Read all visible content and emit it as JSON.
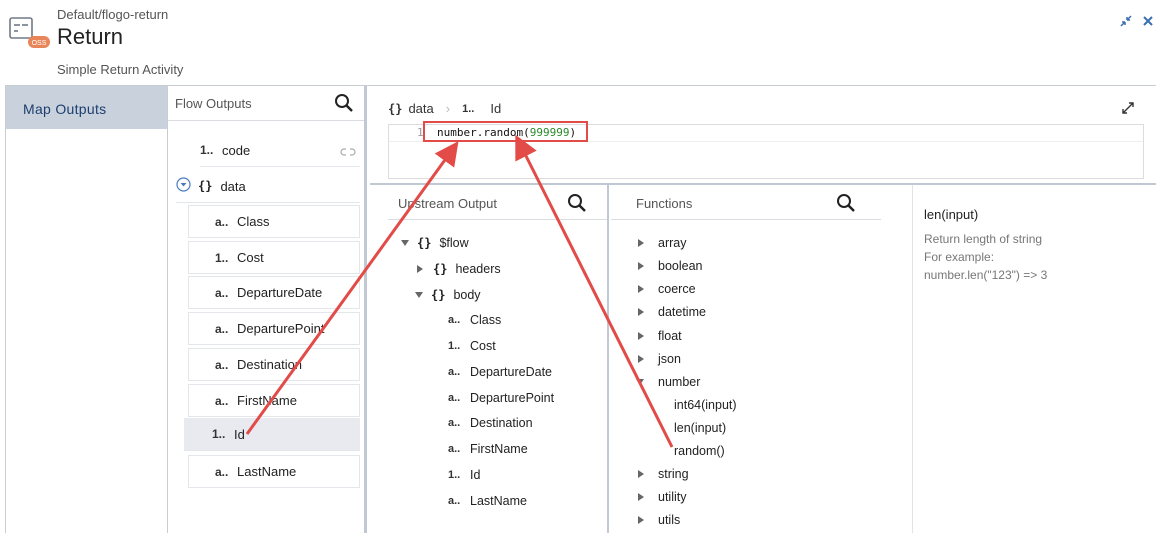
{
  "header": {
    "breadcrumb": "Default/flogo-return",
    "title": "Return",
    "subtitle": "Simple Return Activity",
    "badge": "OSS"
  },
  "nav": {
    "items": [
      {
        "label": "Map Outputs",
        "active": true
      }
    ]
  },
  "flow_outputs": {
    "title": "Flow Outputs",
    "rows": [
      {
        "type": "1..",
        "label": "code"
      },
      {
        "type": "{}",
        "label": "data"
      },
      {
        "type": "a..",
        "label": "Class"
      },
      {
        "type": "1..",
        "label": "Cost"
      },
      {
        "type": "a..",
        "label": "DepartureDate"
      },
      {
        "type": "a..",
        "label": "DeparturePoint"
      },
      {
        "type": "a..",
        "label": "Destination"
      },
      {
        "type": "a..",
        "label": "FirstName"
      },
      {
        "type": "1..",
        "label": "Id",
        "selected": true
      },
      {
        "type": "a..",
        "label": "LastName"
      }
    ]
  },
  "editor": {
    "crumb": {
      "parent": "data",
      "type": "1..",
      "field": "Id"
    },
    "line_number": "1",
    "code_fn": "number.random(",
    "code_arg": "999999",
    "code_close": ")"
  },
  "upstream": {
    "title": "Upstream Output",
    "tree": [
      {
        "label": "$flow",
        "type": "{}",
        "expanded": true
      },
      {
        "label": "headers",
        "type": "{}",
        "expanded": false
      },
      {
        "label": "body",
        "type": "{}",
        "expanded": true
      },
      {
        "label": "Class",
        "type": "a.."
      },
      {
        "label": "Cost",
        "type": "1.."
      },
      {
        "label": "DepartureDate",
        "type": "a.."
      },
      {
        "label": "DeparturePoint",
        "type": "a.."
      },
      {
        "label": "Destination",
        "type": "a.."
      },
      {
        "label": "FirstName",
        "type": "a.."
      },
      {
        "label": "Id",
        "type": "1.."
      },
      {
        "label": "LastName",
        "type": "a.."
      }
    ]
  },
  "functions": {
    "title": "Functions",
    "groups": [
      {
        "label": "array"
      },
      {
        "label": "boolean"
      },
      {
        "label": "coerce"
      },
      {
        "label": "datetime"
      },
      {
        "label": "float"
      },
      {
        "label": "json"
      },
      {
        "label": "number",
        "expanded": true
      },
      {
        "label": "int64(input)",
        "child": true
      },
      {
        "label": "len(input)",
        "child": true
      },
      {
        "label": "random()",
        "child": true
      },
      {
        "label": "string"
      },
      {
        "label": "utility"
      },
      {
        "label": "utils"
      }
    ],
    "detail": {
      "name": "len(input)",
      "description": "Return length of string",
      "example_label": "For example:",
      "example": "number.len(\"123\") => 3"
    }
  },
  "colors": {
    "nav_active_bg": "#c9d1dd",
    "annotation_red": "#e24b47",
    "badge": "#e8865a"
  }
}
